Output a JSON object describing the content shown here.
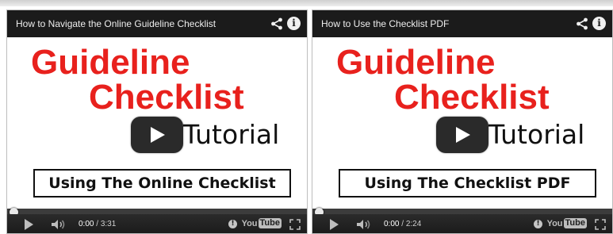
{
  "players": [
    {
      "title": "How to Navigate the Online Guideline Checklist",
      "thumbnail": {
        "line1": "Guideline",
        "line2": "Checklist",
        "line3": "Tutorial",
        "box_label": "Using The Online Checklist"
      },
      "controls": {
        "current_time": "0:00",
        "separator": " / ",
        "duration": "3:31",
        "logo_you": "You",
        "logo_tube": "Tube"
      },
      "icons": [
        "share-icon",
        "info-icon",
        "play-icon",
        "volume-icon",
        "annotations-icon",
        "fullscreen-icon"
      ]
    },
    {
      "title": "How to Use the Checklist PDF",
      "thumbnail": {
        "line1": "Guideline",
        "line2": "Checklist",
        "line3": "Tutorial",
        "box_label": "Using The Checklist PDF"
      },
      "controls": {
        "current_time": "0:00",
        "separator": " / ",
        "duration": "2:24",
        "logo_you": "You",
        "logo_tube": "Tube"
      },
      "icons": [
        "share-icon",
        "info-icon",
        "play-icon",
        "volume-icon",
        "annotations-icon",
        "fullscreen-icon"
      ]
    }
  ],
  "info_glyph": "i",
  "annotation_glyph": "!",
  "colors": {
    "title_bar": "#1b1b1b",
    "brand_red": "#e8211d",
    "control_bar": "#1a1a1a",
    "progress_track": "#3c3c3c"
  }
}
